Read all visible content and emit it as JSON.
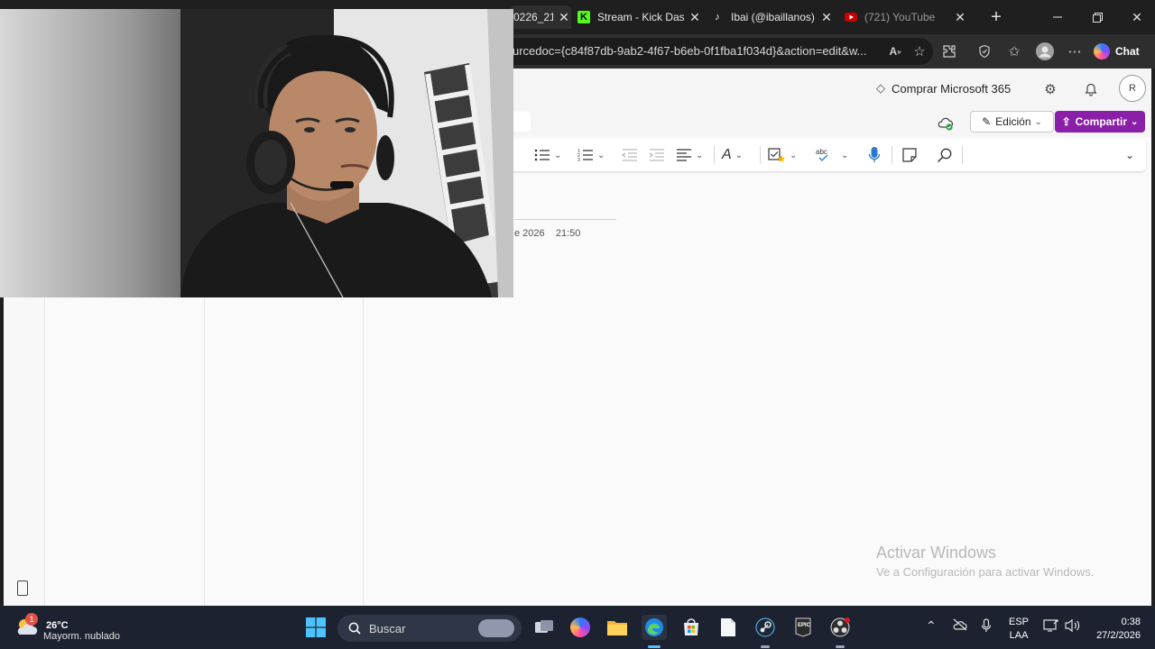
{
  "browser": {
    "tabs": [
      {
        "title": "0226_21",
        "active": true
      },
      {
        "title": "Stream - Kick Dashb",
        "icon": "kick-icon",
        "color": "#53fc18"
      },
      {
        "title": "Ibai (@ibaillanos) |",
        "icon": "tiktok-icon"
      },
      {
        "title": "(721) YouTube",
        "icon": "youtube-icon",
        "color": "#ff0000",
        "dim": true
      }
    ],
    "new_tab_label": "+",
    "url": "urcedoc={c84f87db-9ab2-4f67-b6eb-0f1fba1f034d}&action=edit&w...",
    "chat_label": "Chat"
  },
  "word": {
    "buy_label": "Comprar Microsoft 365",
    "avatar_initial": "R",
    "edicion_label": "Edición",
    "compartir_label": "Compartir",
    "doc_date": "e 2026",
    "doc_time": "21:50",
    "watermark_title": "Activar Windows",
    "watermark_sub": "Ve a Configuración para activar Windows."
  },
  "taskbar": {
    "weather_temp": "26°C",
    "weather_desc": "Mayorm. nublado",
    "weather_badge": "1",
    "search_placeholder": "Buscar",
    "lang_top": "ESP",
    "lang_bottom": "LAA",
    "time": "0:38",
    "date": "27/2/2026"
  }
}
